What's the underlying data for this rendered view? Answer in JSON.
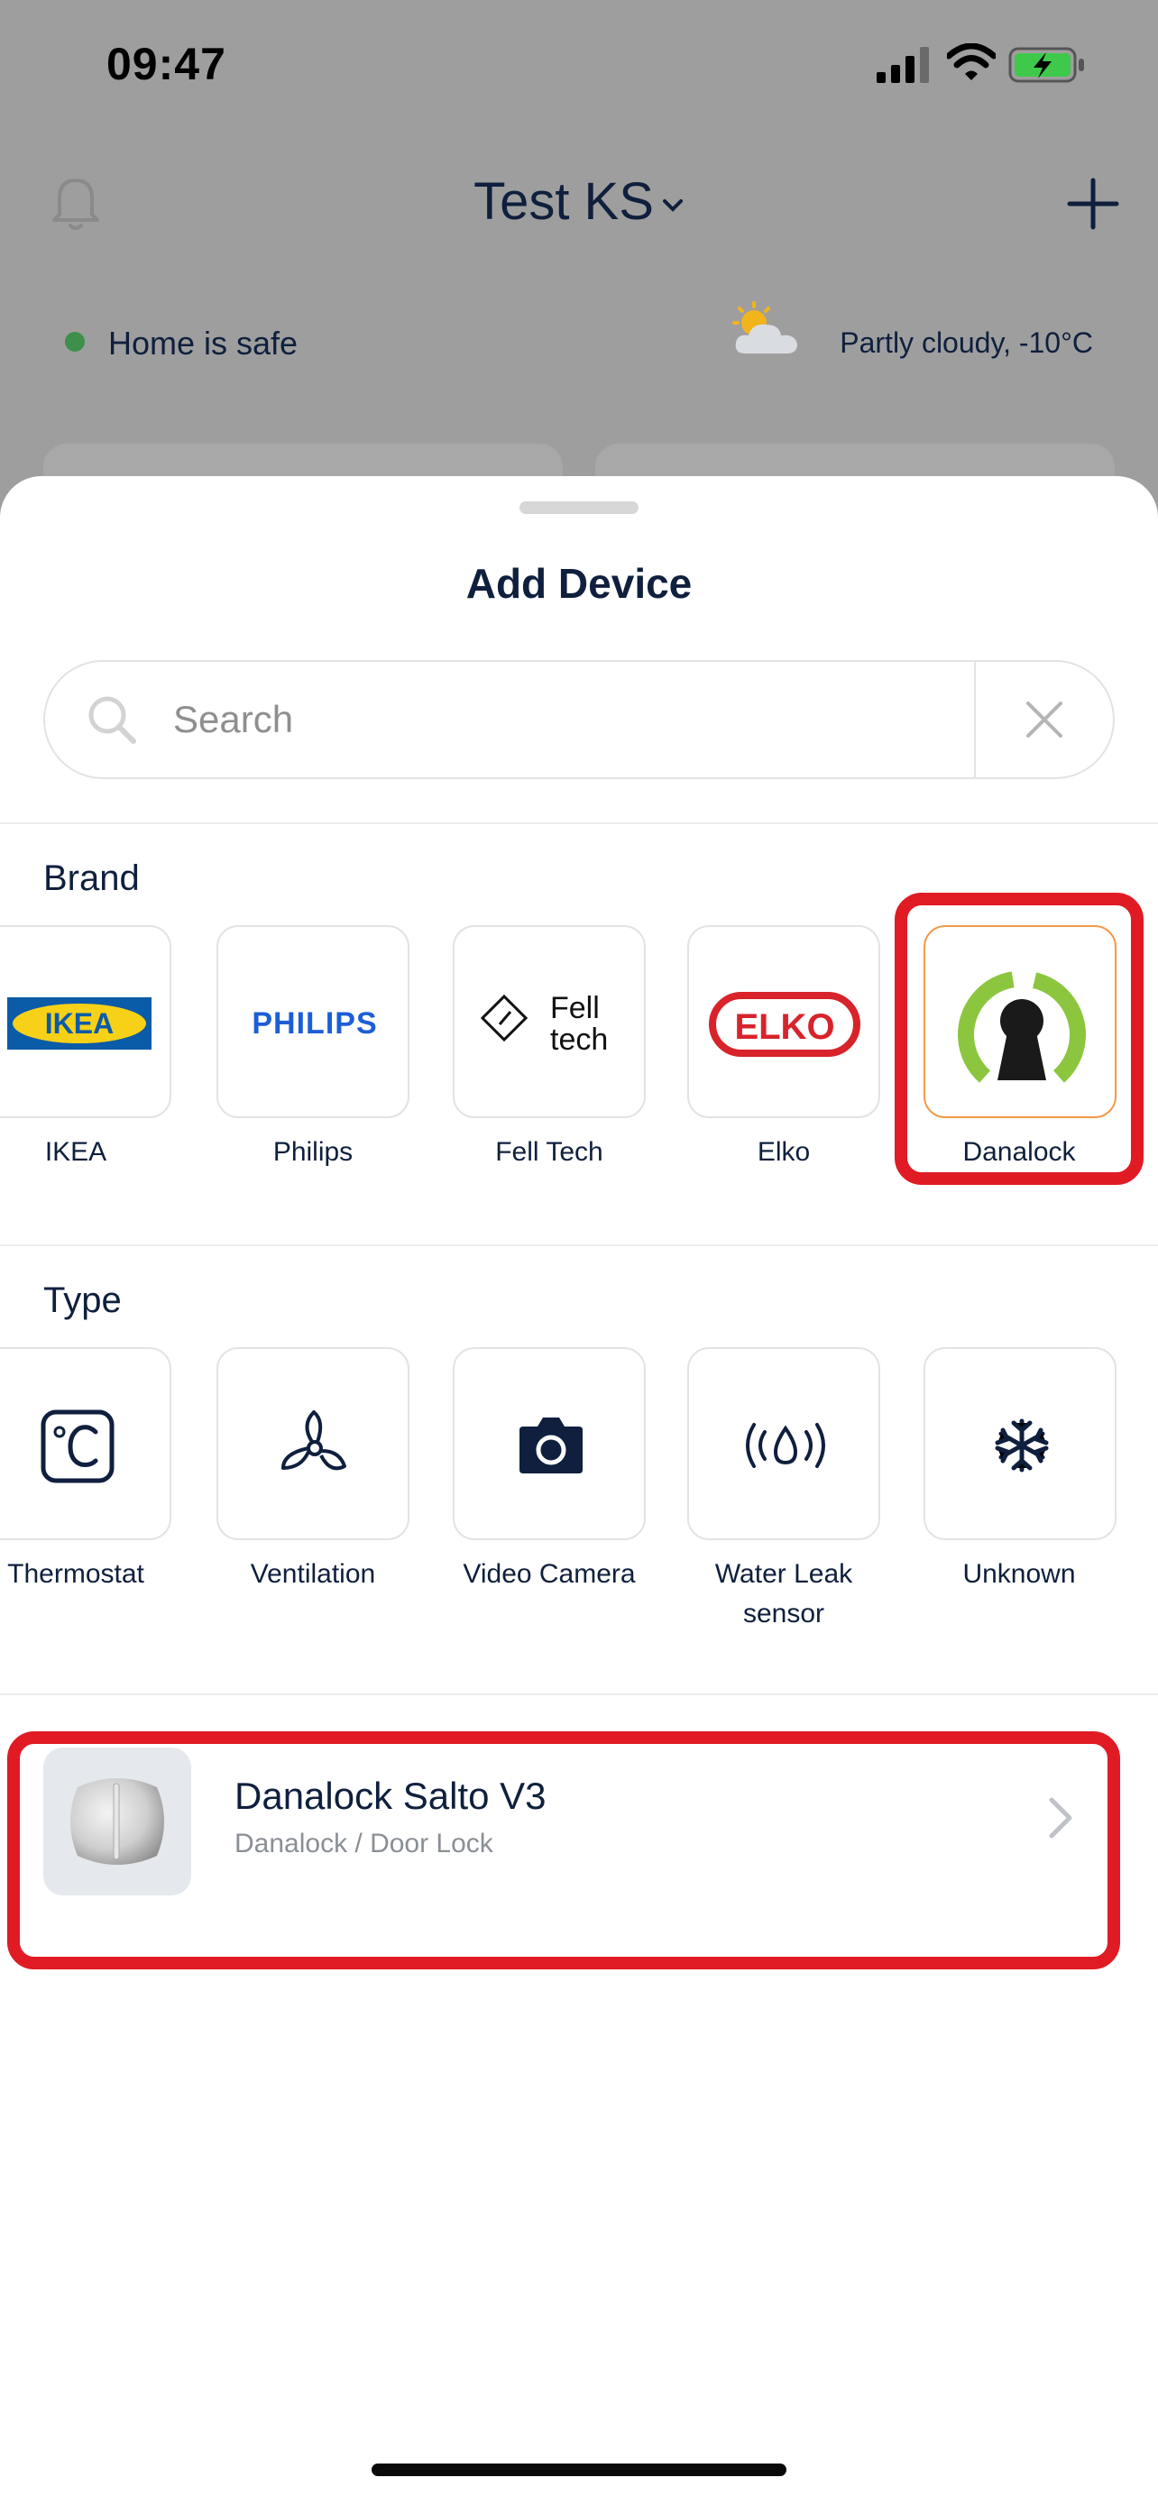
{
  "status_bar": {
    "time": "09:47",
    "signal_icon": "cellular-signal-icon",
    "wifi_icon": "wifi-icon",
    "battery_icon": "battery-charging-icon",
    "battery_color": "#3fc94b"
  },
  "home": {
    "title": "Test KS",
    "bell_icon": "bell-icon",
    "add_icon": "plus-icon",
    "status_text": "Home is safe",
    "status_color": "#3e8f4a",
    "weather_icon": "partly-cloudy-icon",
    "weather_text": "Partly cloudy, -10°C"
  },
  "sheet": {
    "title": "Add Device",
    "search": {
      "placeholder": "Search",
      "value": ""
    },
    "brand_section": {
      "label": "Brand",
      "items": [
        {
          "label": "IKEA",
          "logo_text": "IKEA",
          "selected": false
        },
        {
          "label": "Philips",
          "logo_text": "PHILIPS",
          "selected": false
        },
        {
          "label": "Fell Tech",
          "logo_text": "Fell tech",
          "selected": false
        },
        {
          "label": "Elko",
          "logo_text": "ELKO",
          "selected": false
        },
        {
          "label": "Danalock",
          "logo_text": "",
          "selected": true
        }
      ]
    },
    "type_section": {
      "label": "Type",
      "items": [
        {
          "label": "Thermostat",
          "icon": "thermostat-icon"
        },
        {
          "label": "Ventilation",
          "icon": "fan-icon"
        },
        {
          "label": "Video Camera",
          "icon": "camera-icon"
        },
        {
          "label": "Water Leak sensor",
          "label_line1": "Water Leak",
          "label_line2": "sensor",
          "icon": "water-leak-icon"
        },
        {
          "label": "Unknown",
          "icon": "snowflake-icon"
        }
      ]
    },
    "results": [
      {
        "title": "Danalock Salto V3",
        "subtitle": "Danalock / Door Lock"
      }
    ]
  },
  "colors": {
    "accent_navy": "#0f1f3d",
    "highlight_red": "#e01b24",
    "selected_orange": "#f39a4a",
    "danalock_green": "#8cc63f"
  }
}
